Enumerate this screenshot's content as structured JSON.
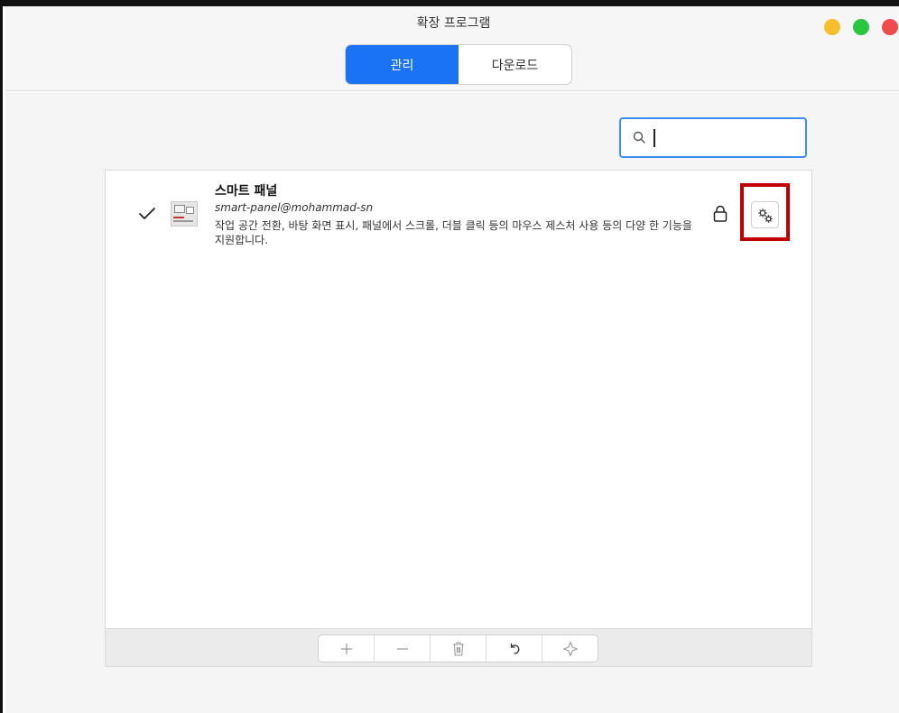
{
  "window": {
    "title": "확장 프로그램",
    "controls": [
      "minimize",
      "maximize",
      "close"
    ]
  },
  "tabs": [
    {
      "label": "관리",
      "active": true
    },
    {
      "label": "다운로드",
      "active": false
    }
  ],
  "search": {
    "value": "",
    "placeholder": ""
  },
  "extensions": [
    {
      "name": "스마트 패널",
      "id": "smart-panel@mohammad-sn",
      "description": "작업 공간 전환, 바탕 화면 표시, 패널에서 스크롤, 더블 클릭 등의 마우스 제스처 사용 등의 다양 한 기능을 지원합니다.",
      "enabled": true,
      "locked": true
    }
  ],
  "toolbar": {
    "buttons": [
      "add-icon",
      "remove-icon",
      "trash-icon",
      "undo-icon",
      "star-icon"
    ]
  },
  "colors": {
    "accent": "#1a73f5",
    "highlight": "#c00000"
  }
}
